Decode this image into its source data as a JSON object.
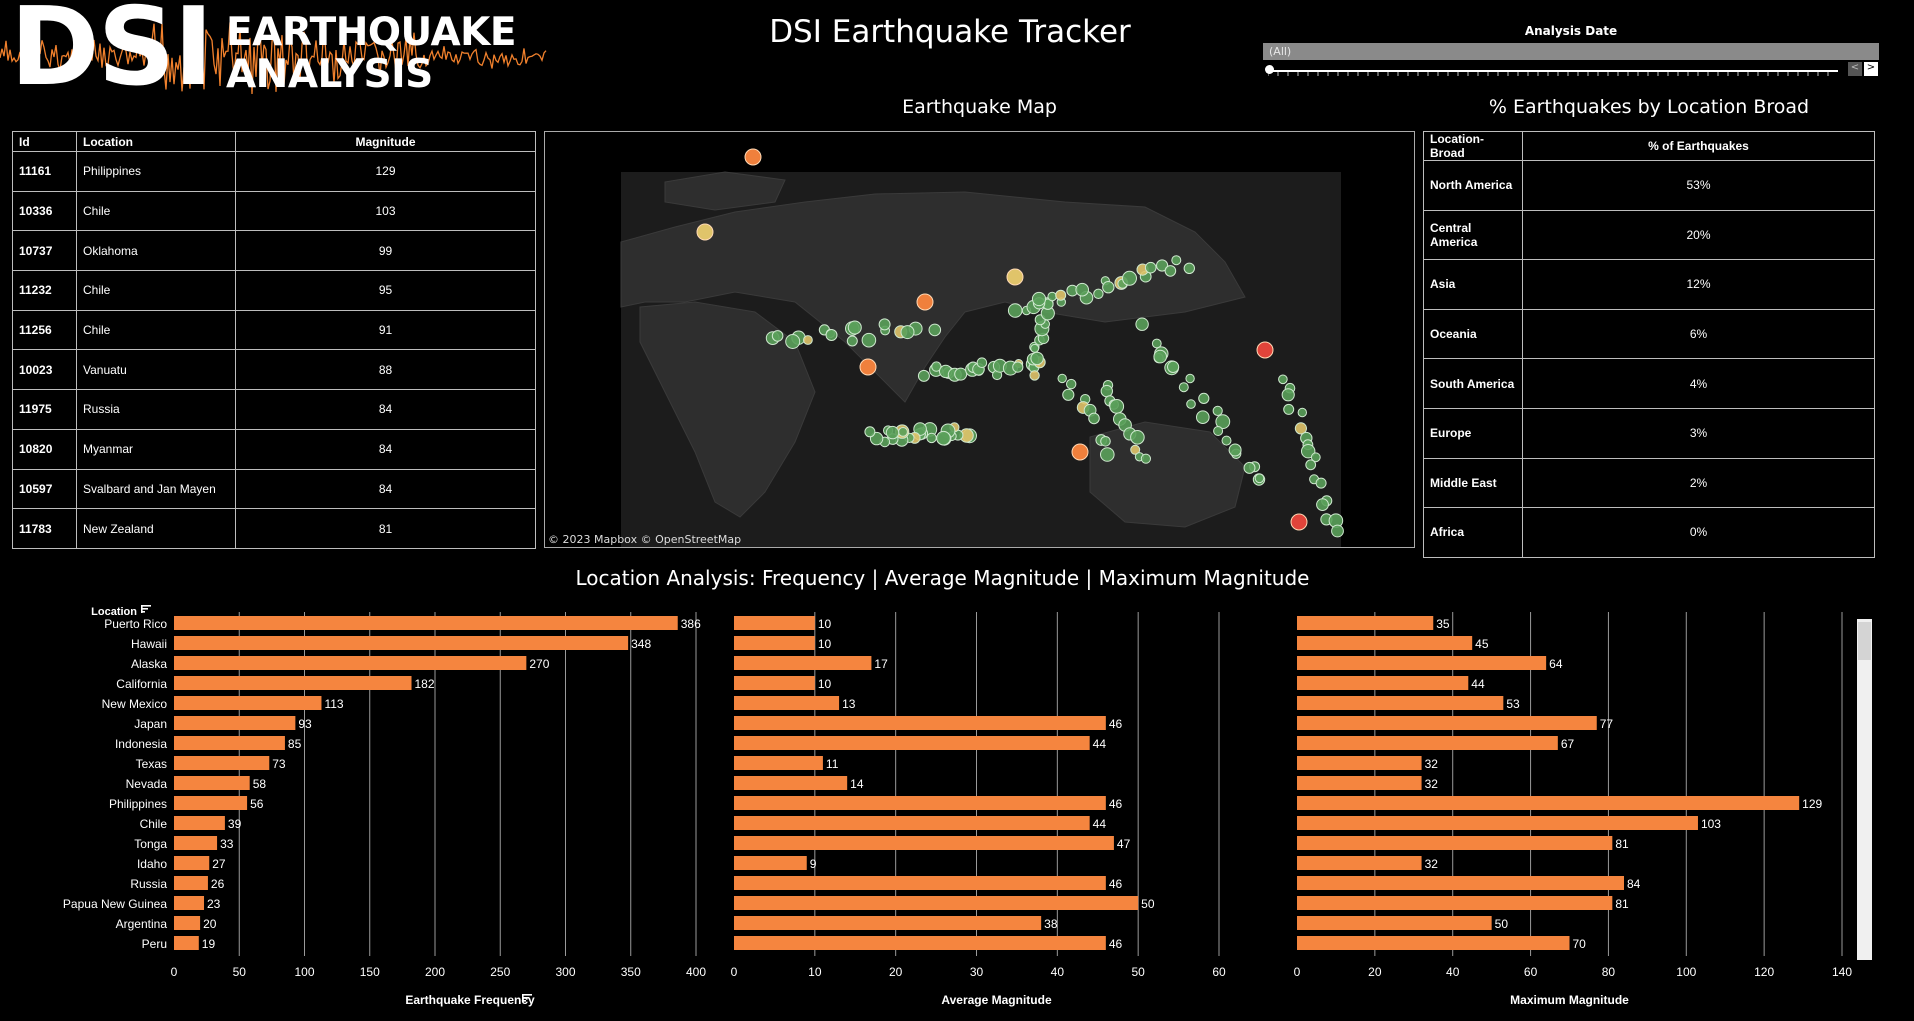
{
  "logo": {
    "big": "DSI",
    "line1": "EARTHQUAKE",
    "line2": "ANALYSIS"
  },
  "header": {
    "title": "DSI Earthquake Tracker"
  },
  "date_filter": {
    "title": "Analysis Date",
    "value": "(All)",
    "prev_icon": "chevron-left-icon",
    "next_icon": "chevron-right-icon",
    "prev_glyph": "<",
    "next_glyph": ">"
  },
  "top_table": {
    "headers": [
      "Id",
      "Location",
      "Magnitude"
    ],
    "rows": [
      [
        "11161",
        "Philippines",
        "129"
      ],
      [
        "10336",
        "Chile",
        "103"
      ],
      [
        "10737",
        "Oklahoma",
        "99"
      ],
      [
        "11232",
        "Chile",
        "95"
      ],
      [
        "11256",
        "Chile",
        "91"
      ],
      [
        "10023",
        "Vanuatu",
        "88"
      ],
      [
        "11975",
        "Russia",
        "84"
      ],
      [
        "10820",
        "Myanmar",
        "84"
      ],
      [
        "10597",
        "Svalbard and Jan Mayen",
        "84"
      ],
      [
        "11783",
        "New Zealand",
        "81"
      ]
    ]
  },
  "map": {
    "title": "Earthquake Map",
    "attribution": "© 2023 Mapbox  © OpenStreetMap"
  },
  "broad": {
    "title": "% Earthquakes by Location Broad",
    "headers": [
      "Location-Broad",
      "% of Earthquakes"
    ],
    "rows": [
      [
        "North America",
        "53%"
      ],
      [
        "Central America",
        "20%"
      ],
      [
        "Asia",
        "12%"
      ],
      [
        "Oceania",
        "6%"
      ],
      [
        "South America",
        "4%"
      ],
      [
        "Europe",
        "3%"
      ],
      [
        "Middle East",
        "2%"
      ],
      [
        "Africa",
        "0%"
      ]
    ]
  },
  "bars": {
    "title": "Location Analysis: Frequency | Average Magnitude | Maximum Magnitude",
    "sort_icon": "sort-icon"
  },
  "colors": {
    "bar": "#f5853f",
    "map_land": "#2e2e2e",
    "map_water": "#1c1c1c",
    "quake_low": "#5aa05a",
    "quake_mid": "#e0c46a",
    "quake_high": "#f0803c",
    "quake_max": "#e0443a"
  },
  "chart_data": [
    {
      "type": "bar",
      "orientation": "horizontal",
      "title": "",
      "category_label": "Location",
      "xlabel": "Earthquake Frequency",
      "categories": [
        "Puerto Rico",
        "Hawaii",
        "Alaska",
        "California",
        "New Mexico",
        "Japan",
        "Indonesia",
        "Texas",
        "Nevada",
        "Philippines",
        "Chile",
        "Tonga",
        "Idaho",
        "Russia",
        "Papua New Guinea",
        "Argentina",
        "Peru"
      ],
      "values": [
        386,
        348,
        270,
        182,
        113,
        93,
        85,
        73,
        58,
        56,
        39,
        33,
        27,
        26,
        23,
        20,
        19
      ],
      "xlim": [
        0,
        400
      ],
      "ticks": [
        0,
        50,
        100,
        150,
        200,
        250,
        300,
        350,
        400
      ],
      "grid": true
    },
    {
      "type": "bar",
      "orientation": "horizontal",
      "title": "",
      "xlabel": "Average Magnitude",
      "categories": [
        "Puerto Rico",
        "Hawaii",
        "Alaska",
        "California",
        "New Mexico",
        "Japan",
        "Indonesia",
        "Texas",
        "Nevada",
        "Philippines",
        "Chile",
        "Tonga",
        "Idaho",
        "Russia",
        "Papua New Guinea",
        "Argentina",
        "Peru"
      ],
      "values": [
        10,
        10,
        17,
        10,
        13,
        46,
        44,
        11,
        14,
        46,
        44,
        47,
        9,
        46,
        50,
        38,
        46
      ],
      "xlim": [
        0,
        60
      ],
      "ticks": [
        0,
        10,
        20,
        30,
        40,
        50,
        60
      ],
      "grid": true
    },
    {
      "type": "bar",
      "orientation": "horizontal",
      "title": "",
      "xlabel": "Maximum Magnitude",
      "categories": [
        "Puerto Rico",
        "Hawaii",
        "Alaska",
        "California",
        "New Mexico",
        "Japan",
        "Indonesia",
        "Texas",
        "Nevada",
        "Philippines",
        "Chile",
        "Tonga",
        "Idaho",
        "Russia",
        "Papua New Guinea",
        "Argentina",
        "Peru"
      ],
      "values": [
        35,
        45,
        64,
        44,
        53,
        77,
        67,
        32,
        32,
        129,
        103,
        81,
        32,
        84,
        81,
        50,
        70
      ],
      "xlim": [
        0,
        140
      ],
      "ticks": [
        0,
        20,
        40,
        60,
        80,
        100,
        120,
        140
      ],
      "grid": true
    }
  ]
}
